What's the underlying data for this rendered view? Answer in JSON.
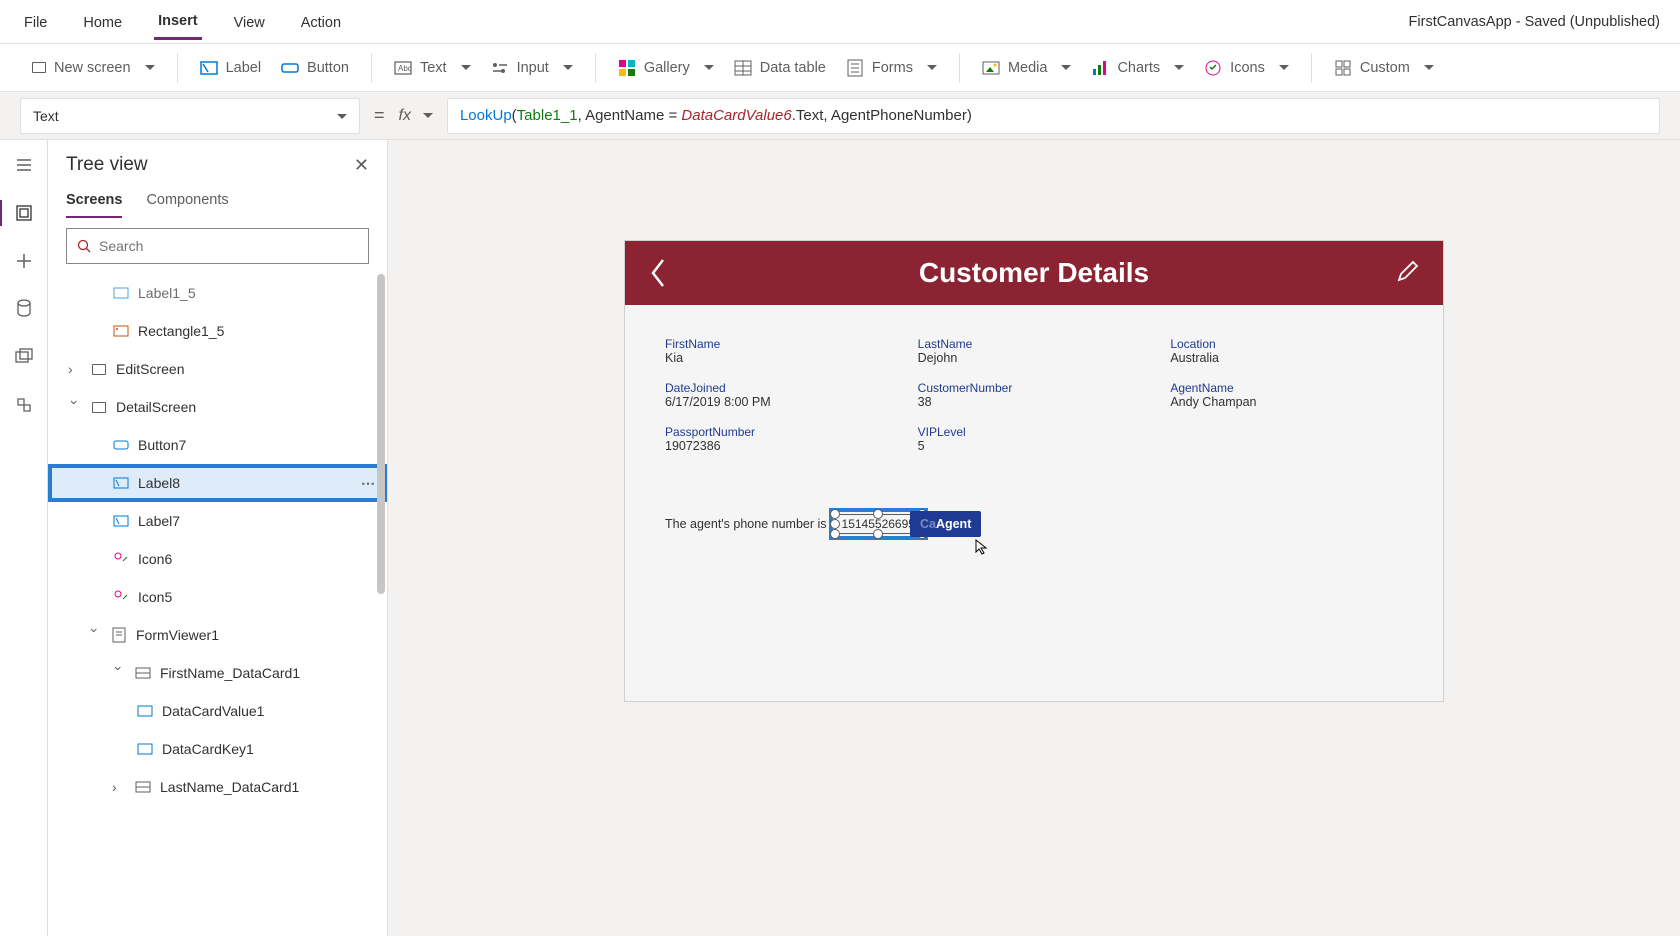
{
  "top_menu": {
    "file": "File",
    "home": "Home",
    "insert": "Insert",
    "view": "View",
    "action": "Action",
    "app_title": "FirstCanvasApp - Saved (Unpublished)"
  },
  "ribbon": {
    "new_screen": "New screen",
    "label": "Label",
    "button": "Button",
    "text": "Text",
    "input": "Input",
    "gallery": "Gallery",
    "data_table": "Data table",
    "forms": "Forms",
    "media": "Media",
    "charts": "Charts",
    "icons": "Icons",
    "custom": "Custom"
  },
  "formula": {
    "property": "Text",
    "fn": "LookUp",
    "p1": "(",
    "arg1": "Table1_1",
    "p2": ", AgentName = ",
    "arg_red": "DataCardValue6",
    "p3": ".Text, AgentPhoneNumber)"
  },
  "tree": {
    "title": "Tree view",
    "tab_screens": "Screens",
    "tab_components": "Components",
    "search_ph": "Search",
    "items": [
      "Label1_5",
      "Rectangle1_5",
      "EditScreen",
      "DetailScreen",
      "Button7",
      "Label8",
      "Label7",
      "Icon6",
      "Icon5",
      "FormViewer1",
      "FirstName_DataCard1",
      "DataCardValue1",
      "DataCardKey1",
      "LastName_DataCard1"
    ]
  },
  "canvas": {
    "header": "Customer Details",
    "labels": {
      "firstname": "FirstName",
      "lastname": "LastName",
      "location": "Location",
      "datejoined": "DateJoined",
      "custnum": "CustomerNumber",
      "agentname": "AgentName",
      "passport": "PassportNumber",
      "vip": "VIPLevel"
    },
    "values": {
      "firstname": "Kia",
      "lastname": "Dejohn",
      "location": "Australia",
      "datejoined": "6/17/2019 8:00 PM",
      "custnum": "38",
      "agentname": "Andy Champan",
      "passport": "19072386",
      "vip": "5"
    },
    "agent_text_prefix": "The agent's phone number is ",
    "agent_phone": "15145526695",
    "call_btn_prefix": "Ca",
    "call_btn": "Agent"
  }
}
